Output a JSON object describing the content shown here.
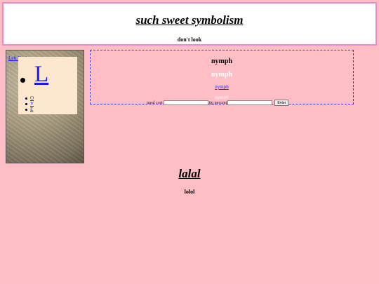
{
  "header": {
    "title": "such sweet symbolism",
    "subtitle": "don't look"
  },
  "sidebar": {
    "nav_label": "Left Navbar",
    "big_letter": "L",
    "items": [
      "O",
      "V",
      "E"
    ]
  },
  "content": {
    "heading": "nymph",
    "heading_white": "nymph",
    "link": "nymph",
    "ghost": "nymph"
  },
  "form": {
    "meal_label": "meal cost",
    "meal_value": "",
    "tip_label": "tip percent",
    "tip_value": "",
    "enter_label": "Enter"
  },
  "footer": {
    "title": "lalal",
    "subtitle": "lolol"
  }
}
